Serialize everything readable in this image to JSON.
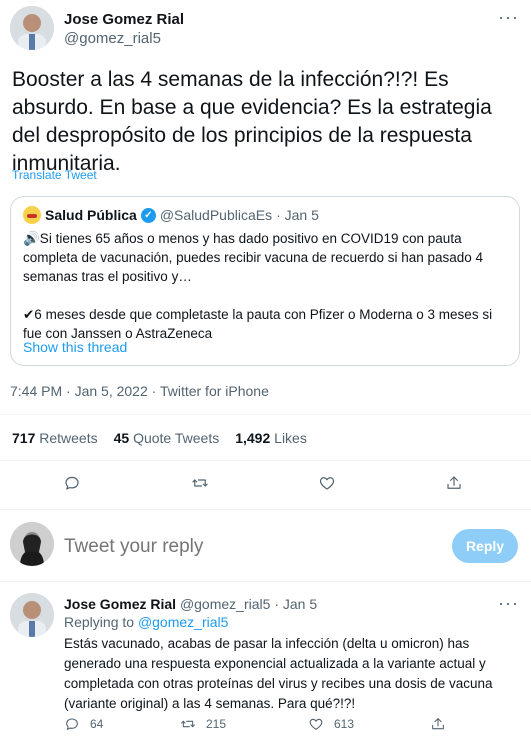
{
  "tweet": {
    "author_name": "Jose Gomez Rial",
    "author_handle": "@gomez_rial5",
    "text": "Booster a las 4 semanas de la infección?!?! Es absurdo. En base a que evidencia? Es la estrategia del despropósito de los principios de la respuesta inmunitaria.",
    "translate_label": "Translate Tweet",
    "timestamp": "7:44 PM · Jan 5, 2022 · Twitter for iPhone"
  },
  "quoted": {
    "name": "Salud Pública",
    "handle": "@SaludPublicaEs",
    "date": "· Jan 5",
    "line1": "🔊Si tienes 65 años o menos y has dado positivo en COVID19 con pauta completa de vacunación, puedes recibir vacuna de recuerdo si han pasado 4 semanas tras el positivo y…",
    "line2": "✔6 meses desde que completaste la pauta con Pfizer o Moderna o 3 meses si fue con Janssen o AstraZeneca",
    "show_thread": "Show this thread"
  },
  "stats": {
    "retweets_count": "717",
    "retweets_label": "Retweets",
    "quotes_count": "45",
    "quotes_label": "Quote Tweets",
    "likes_count": "1,492",
    "likes_label": "Likes"
  },
  "composer": {
    "placeholder": "Tweet your reply",
    "button_label": "Reply"
  },
  "reply": {
    "author_name": "Jose Gomez Rial",
    "author_handle": "@gomez_rial5",
    "date": "· Jan 5",
    "replying_prefix": "Replying to",
    "replying_to": "@gomez_rial5",
    "text": "Estás vacunado, acabas de pasar la infección (delta u omicron) has generado una respuesta exponencial actualizada a la variante actual y completada con otras proteínas del virus  y recibes una dosis de vacuna (variante original) a las 4 semanas. Para qué?!?!",
    "reply_count": "64",
    "retweet_count": "215",
    "like_count": "613"
  },
  "icons": {
    "more": "more-horizontal-icon",
    "reply": "comment-icon",
    "retweet": "retweet-icon",
    "like": "heart-icon",
    "share": "share-icon",
    "verified": "verified-badge-icon"
  },
  "colors": {
    "accent": "#1d9bf0",
    "reply_button": "#8ecdf7",
    "secondary_text": "#536471",
    "border": "#cfd9de"
  }
}
